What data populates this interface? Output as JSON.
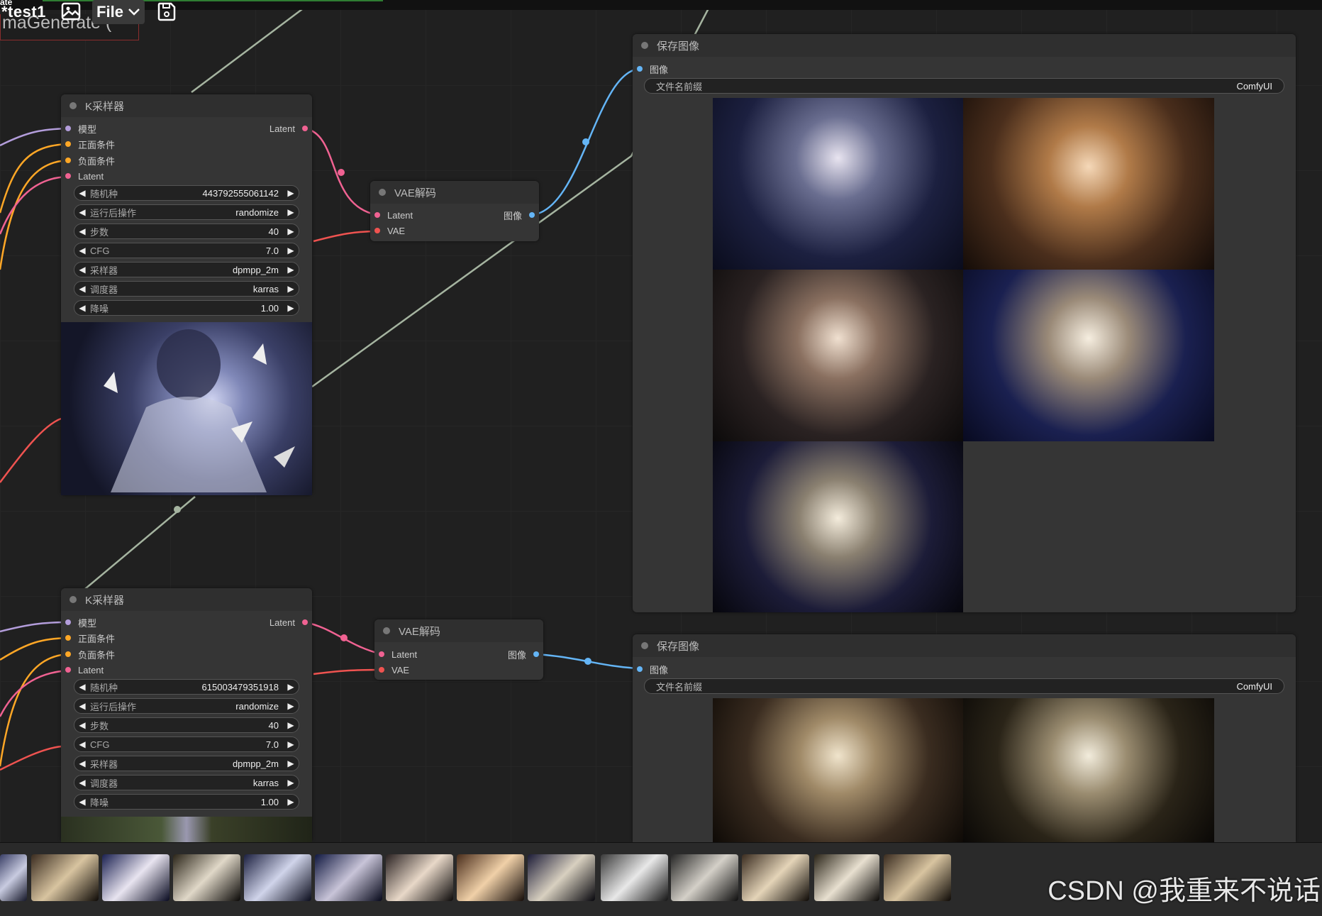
{
  "topbar": {
    "stub_text": "ate",
    "workflow_name": "*test1",
    "file_menu": "File",
    "partial_node_title": "maGenerate ("
  },
  "ksampler_1": {
    "title": "K采样器",
    "inputs": [
      "模型",
      "正面条件",
      "负面条件",
      "Latent"
    ],
    "output": "Latent",
    "widgets": [
      {
        "label": "随机种",
        "value": "443792555061142"
      },
      {
        "label": "运行后操作",
        "value": "randomize"
      },
      {
        "label": "步数",
        "value": "40"
      },
      {
        "label": "CFG",
        "value": "7.0"
      },
      {
        "label": "采样器",
        "value": "dpmpp_2m"
      },
      {
        "label": "调度器",
        "value": "karras"
      },
      {
        "label": "降噪",
        "value": "1.00"
      }
    ]
  },
  "ksampler_2": {
    "title": "K采样器",
    "inputs": [
      "模型",
      "正面条件",
      "负面条件",
      "Latent"
    ],
    "output": "Latent",
    "widgets": [
      {
        "label": "随机种",
        "value": "615003479351918"
      },
      {
        "label": "运行后操作",
        "value": "randomize"
      },
      {
        "label": "步数",
        "value": "40"
      },
      {
        "label": "CFG",
        "value": "7.0"
      },
      {
        "label": "采样器",
        "value": "dpmpp_2m"
      },
      {
        "label": "调度器",
        "value": "karras"
      },
      {
        "label": "降噪",
        "value": "1.00"
      }
    ]
  },
  "vae_1": {
    "title": "VAE解码",
    "inputs": [
      "Latent",
      "VAE"
    ],
    "output": "图像"
  },
  "vae_2": {
    "title": "VAE解码",
    "inputs": [
      "Latent",
      "VAE"
    ],
    "output": "图像"
  },
  "save_1": {
    "title": "保存图像",
    "input": "图像",
    "prefix_label": "文件名前缀",
    "prefix_value": "ComfyUI"
  },
  "save_2": {
    "title": "保存图像",
    "input": "图像",
    "prefix_label": "文件名前缀",
    "prefix_value": "ComfyUI"
  },
  "watermark": "CSDN @我重来不说话",
  "colors": {
    "model_wire": "#b39ddb",
    "cond_wire": "#ffa726",
    "latent_wire": "#f06292",
    "vae_wire": "#ef5350",
    "image_wire": "#64b5f6",
    "clip_wire": "#a5b4a0"
  }
}
